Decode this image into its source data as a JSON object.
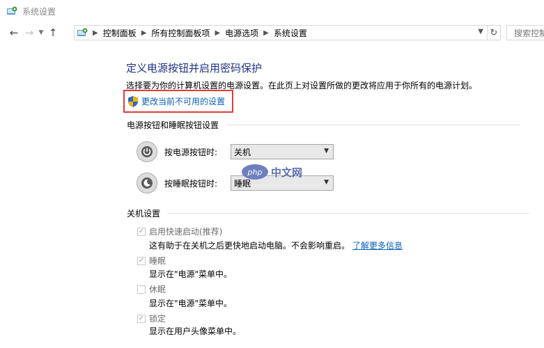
{
  "window": {
    "title": "系统设置"
  },
  "navigation": {
    "back_icon": "arrow-left-icon",
    "forward_icon": "arrow-right-icon",
    "recent_icon": "chevron-down-icon",
    "up_icon": "arrow-up-icon",
    "breadcrumb": [
      "控制面板",
      "所有控制面板项",
      "电源选项",
      "系统设置"
    ],
    "search_placeholder": "搜索控制"
  },
  "main": {
    "title": "定义电源按钮并启用密码保护",
    "description": "选择要为你的计算机设置的电源设置。在此页上对设置所做的更改将应用于你所有的电源计划。",
    "change_link": "更改当前不可用的设置",
    "button_section": {
      "header": "电源按钮和睡眠按钮设置",
      "rows": [
        {
          "label": "按电源按钮时:",
          "value": "关机",
          "icon": "power-icon"
        },
        {
          "label": "按睡眠按钮时:",
          "value": "睡眠",
          "icon": "sleep-icon"
        }
      ]
    },
    "shutdown_section": {
      "header": "关机设置",
      "items": [
        {
          "label": "启用快速启动(推荐)",
          "checked": true,
          "description": "这有助于在关机之后更快地启动电脑。不会影响重启。",
          "link": "了解更多信息"
        },
        {
          "label": "睡眠",
          "checked": true,
          "description": "显示在\"电源\"菜单中。"
        },
        {
          "label": "休眠",
          "checked": false,
          "description": "显示在\"电源\"菜单中。"
        },
        {
          "label": "锁定",
          "checked": true,
          "description": "显示在用户头像菜单中。"
        }
      ]
    }
  },
  "watermark": {
    "badge": "php",
    "text": "中文网"
  },
  "colors": {
    "title_blue": "#1e3287",
    "link_blue": "#0b5fb7",
    "highlight_red": "#e23a3a"
  }
}
